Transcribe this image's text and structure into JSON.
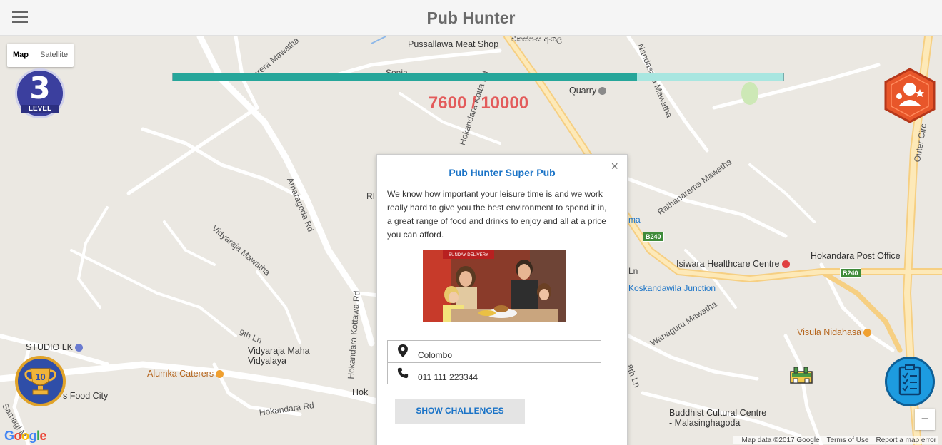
{
  "app": {
    "title": "Pub Hunter"
  },
  "map_type": {
    "options": [
      "Map",
      "Satellite"
    ],
    "selected": "Map"
  },
  "level": {
    "number": "3",
    "label": "LEVEL"
  },
  "progress": {
    "current": 7600,
    "max": 10000,
    "fraction": 0.76,
    "text": "7600 / 10000"
  },
  "trophy": {
    "count": "10"
  },
  "zoom": {
    "out_label": "−",
    "in_label": "+"
  },
  "map_labels": {
    "pussallawa": "Pussallawa Meat Shop",
    "sinhala_top": "එකස්පංස අංගල",
    "quarry": "Quarry",
    "perera": "Perera Mawatha",
    "nandasara": "Nandasara Mawatha",
    "hokandara_kotta": "Hokandara Kotta Rd",
    "amaragoda": "Amaragoda Rd",
    "vidyaraja": "Vidyaraja Mawatha",
    "ri": "RI",
    "rathanarama": "Rathanarama Mawatha",
    "isiwara": "Isiwara Healthcare Centre",
    "post_office": "Hokandara Post Office",
    "koskandawila": "Koskandawila Junction",
    "wanaguru": "Wanaguru Mawatha",
    "visula": "Visula Nidahasa",
    "studio": "STUDIO LK",
    "ninth_ln": "9th Ln",
    "vidyaraja_maha": "Vidyaraja Maha Vidyalaya",
    "alumka": "Alumka Caterers",
    "food_city": "s Food City",
    "kottawa_rd": "Hokandara Kottawa Rd",
    "hokandara_rd": "Hokandara Rd",
    "hok": "Hok",
    "samagi": "Samagi M",
    "buddhist": "Buddhist Cultural Centre",
    "malasinghagoda": "- Malasinghagoda",
    "ninth_ln_b": "8th Ln",
    "outer_circ": "Outer Circ",
    "b240_a": "B240",
    "b240_b": "B240",
    "ma": "ma",
    "ln": "Ln",
    "sonia": "Sonia"
  },
  "attribution": {
    "google": "Google",
    "map_data": "Map data ©2017 Google",
    "terms": "Terms of Use",
    "report": "Report a map error"
  },
  "popup": {
    "close": "×",
    "title": "Pub Hunter Super Pub",
    "description": "We know how important your leisure time is and we work really hard to give you the best environment to spend it in, a great range of food and drinks to enjoy and all at a price you can afford.",
    "location": "Colombo",
    "phone": "011 111 223344",
    "button": "SHOW CHALLENGES",
    "image_sign": "SUNDAY DELIVERY"
  },
  "colors": {
    "accent": "#1a73c7",
    "progress_fill": "#26a69a",
    "progress_track": "#a8e6e0",
    "progress_text": "#e35b5b"
  }
}
